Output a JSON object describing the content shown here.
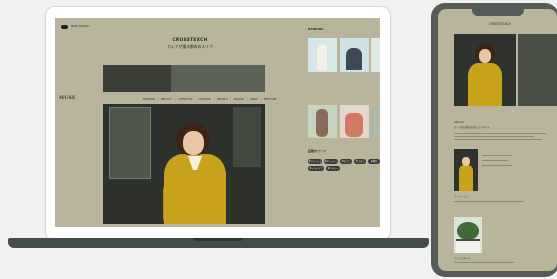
{
  "laptop": {
    "menu_label": "MENU  SEARCH",
    "site_title": "CROSSTEXCH",
    "site_subtitle": "カレアが描る都市のスイブ",
    "brand": "MUSE",
    "nav": [
      "FASHION",
      "BEAUTY",
      "LIFESTYLE",
      "CULTURE",
      "PEOPLE",
      "TRAVEL",
      "SHOP",
      "FEATURE"
    ],
    "sidebar_heading": "RANKING",
    "tags_heading": "話題のワード",
    "tags": [
      "#ファッション",
      "#ビューティー",
      "#カフェ",
      "#コスメ",
      "#旅行",
      "#インテリア",
      "#ヘルシー"
    ]
  },
  "phone": {
    "header": "CROSSTEXCH",
    "article1_title": "ARTICLE",
    "article1_caption": "カレア描る都市の新しいスタイル",
    "article2_caption": "ファッション",
    "article3_caption": "ライフスタイル"
  }
}
